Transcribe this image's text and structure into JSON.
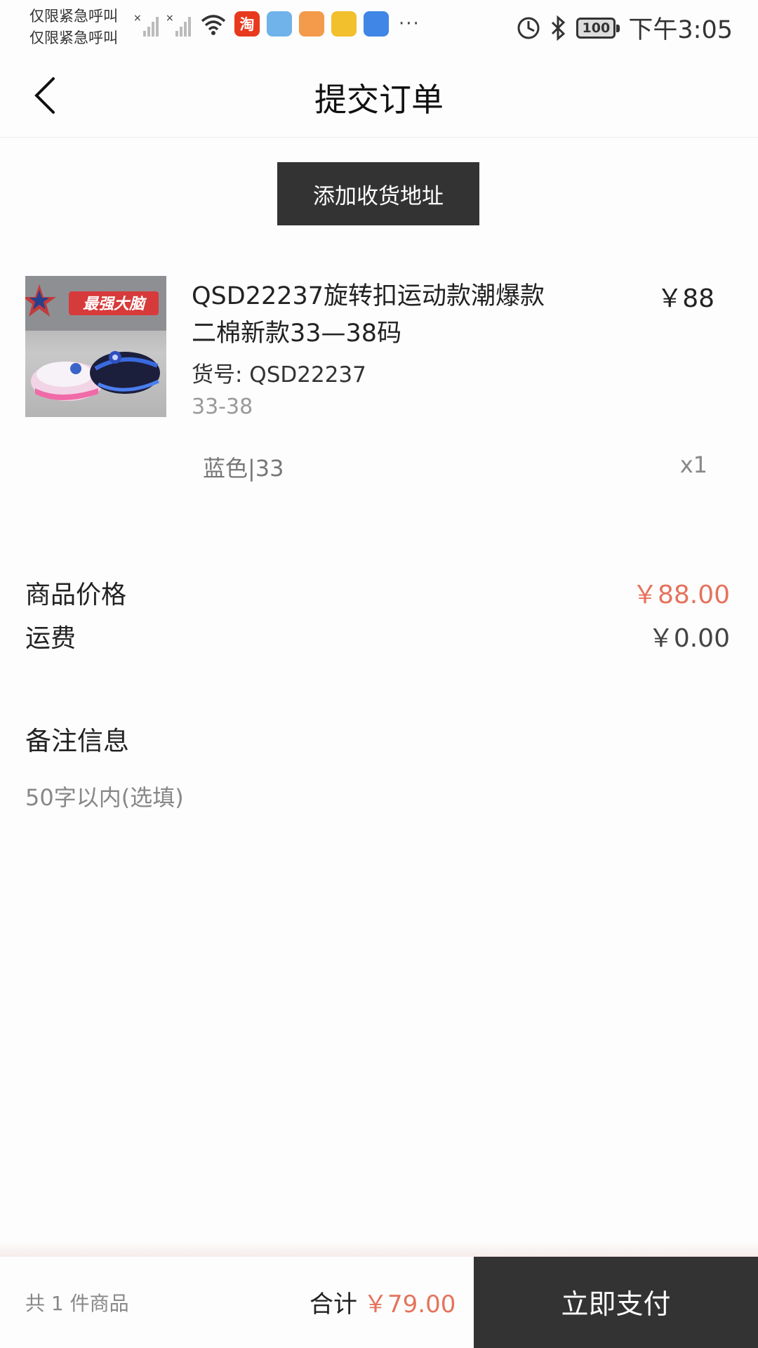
{
  "status_bar": {
    "carrier_line_1": "仅限紧急呼叫",
    "carrier_line_2": "仅限紧急呼叫",
    "app_icons": [
      {
        "name": "taobao-icon",
        "label": "淘",
        "color": "#e8391e"
      },
      {
        "name": "cloud-app-icon",
        "label": "",
        "color": "#6fb3ea"
      },
      {
        "name": "bookmark-app-icon",
        "label": "",
        "color": "#f39a4b"
      },
      {
        "name": "weibo-icon",
        "label": "",
        "color": "#f2bf2d"
      },
      {
        "name": "browser-app-icon",
        "label": "",
        "color": "#3f86e6"
      }
    ],
    "more": "···",
    "battery": "100",
    "time": "下午3:05"
  },
  "header": {
    "title": "提交订单"
  },
  "address": {
    "add_label": "添加收货地址"
  },
  "product": {
    "title": "QSD22237旋转扣运动款潮爆款二棉新款33—38码",
    "price": "￥88",
    "sku": "货号: QSD22237",
    "size_range": "33-38",
    "variant": "蓝色|33",
    "quantity": "x1",
    "image_brand_text": "最强大脑"
  },
  "summary": {
    "goods_price_label": "商品价格",
    "goods_price_value": "￥88.00",
    "shipping_label": "运费",
    "shipping_value": "￥0.00"
  },
  "remark": {
    "title": "备注信息",
    "placeholder": "50字以内(选填)"
  },
  "bottom_bar": {
    "item_count": "共 1 件商品",
    "total_label": "合计",
    "total_value": "￥79.00",
    "pay_label": "立即支付"
  },
  "colors": {
    "accent": "#e5735c",
    "dark_button": "#333333",
    "muted_text": "#888888"
  }
}
